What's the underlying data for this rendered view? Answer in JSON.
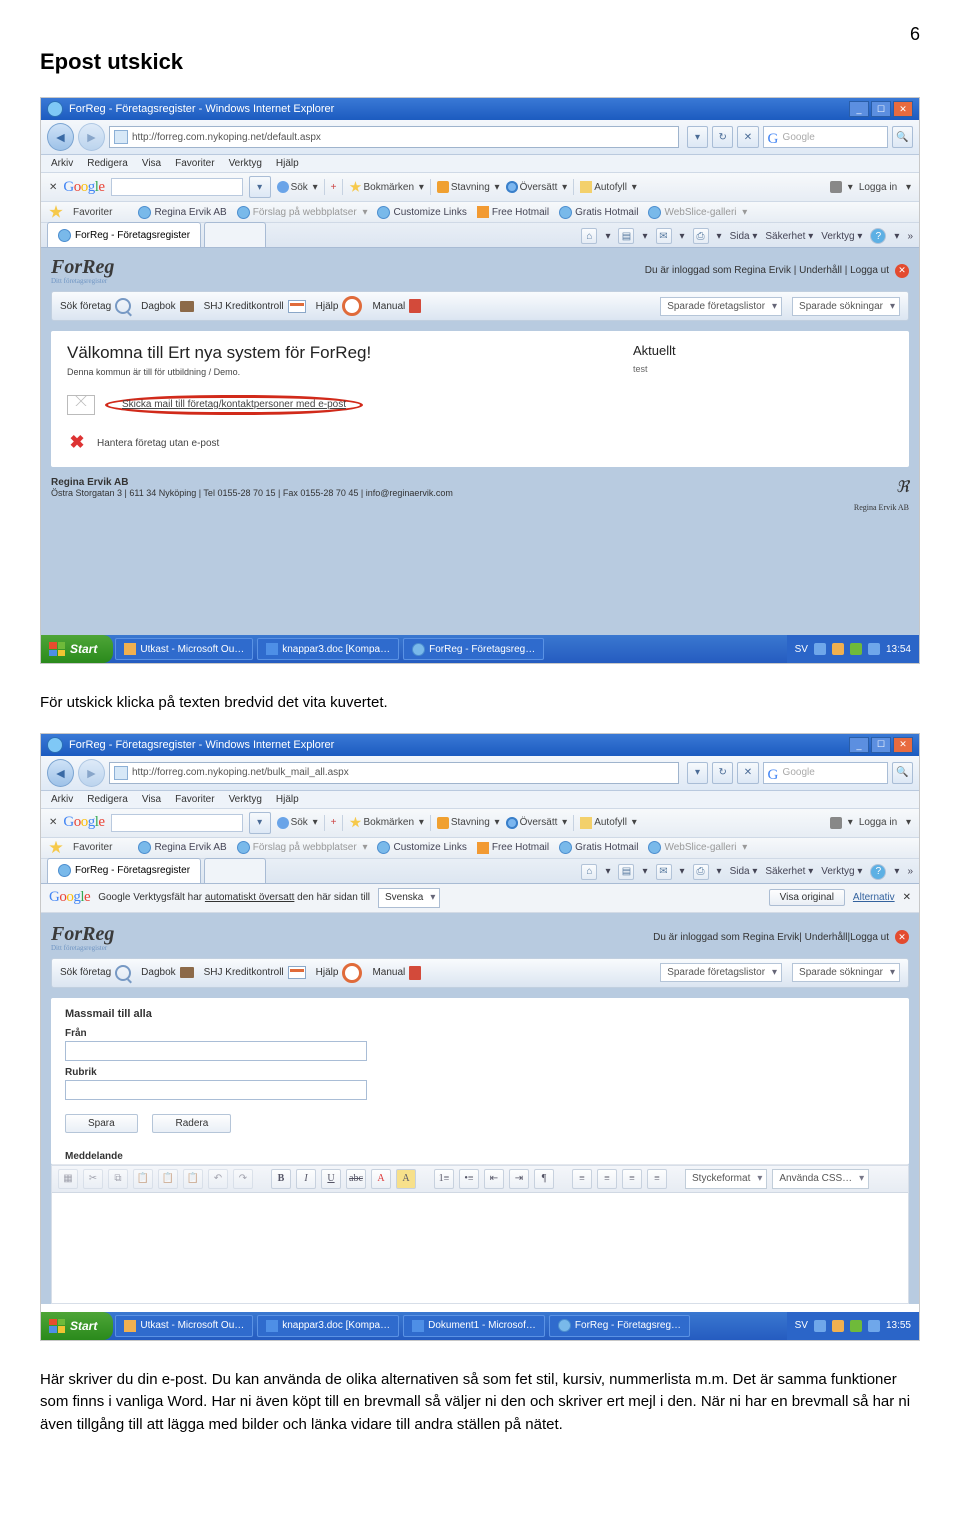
{
  "page": {
    "number": "6",
    "heading": "Epost utskick"
  },
  "para1": "För utskick klicka på texten bredvid det vita kuvertet.",
  "para2": "Här skriver du din e-post. Du kan använda de olika alternativen så som fet stil, kursiv, nummerlista m.m. Det är samma funktioner som finns i vanliga Word.  Har ni även köpt till en brevmall så väljer ni den och skriver ert mejl i den. När ni har en brevmall så har ni även tillgång till att lägga med bilder och länka vidare till andra ställen på nätet.",
  "s1": {
    "window_title": "ForReg - Företagsregister - Windows Internet Explorer",
    "url": "http://forreg.com.nykoping.net/default.aspx",
    "search_placeholder": "Google",
    "menus": [
      "Arkiv",
      "Redigera",
      "Visa",
      "Favoriter",
      "Verktyg",
      "Hjälp"
    ],
    "google_tb": {
      "brand": "Google",
      "search": "Sök",
      "bookmarks": "Bokmärken",
      "spell": "Stavning",
      "translate": "Översätt",
      "autofill": "Autofyll",
      "login": "Logga in"
    },
    "fav": {
      "label": "Favoriter",
      "sites": [
        "Regina Ervik AB",
        "Förslag på webbplatser",
        "Customize Links",
        "Free Hotmail",
        "Gratis Hotmail",
        "WebSlice-galleri"
      ]
    },
    "tab": "ForReg - Företagsregister",
    "cmd": {
      "page": "Sida",
      "safety": "Säkerhet",
      "tools": "Verktyg"
    },
    "app": {
      "logged_in": "Du är inloggad som Regina Ervik | Underhåll | Logga ut",
      "nav": {
        "search": "Sök företag",
        "diary": "Dagbok",
        "credit": "SHJ Kreditkontroll",
        "help": "Hjälp",
        "manual": "Manual",
        "saved_lists": "Sparade företagslistor",
        "saved_search": "Sparade sökningar"
      },
      "welcome_title": "Välkomna till Ert nya system för ForReg!",
      "welcome_sub": "Denna kommun är till för utbildning / Demo.",
      "action_mail": "Skicka mail till företag/kontaktpersoner med e-post",
      "action_nomail": "Hantera företag utan e-post",
      "news_title": "Aktuellt",
      "news_body": "test",
      "footer_name": "Regina Ervik AB",
      "footer_addr": "Östra Storgatan 3 | 611 34 Nyköping | Tel 0155-28 70 15 | Fax 0155-28 70 45 | info@reginaervik.com",
      "footer_brand": "Regina Ervik AB"
    },
    "taskbar": {
      "start": "Start",
      "items": [
        "Utkast - Microsoft Ou…",
        "knappar3.doc [Kompa…",
        "ForReg - Företagsreg…"
      ],
      "lang": "SV",
      "time": "13:54"
    }
  },
  "s2": {
    "window_title": "ForReg - Företagsregister - Windows Internet Explorer",
    "url": "http://forreg.com.nykoping.net/bulk_mail_all.aspx",
    "search_placeholder": "Google",
    "menus": [
      "Arkiv",
      "Redigera",
      "Visa",
      "Favoriter",
      "Verktyg",
      "Hjälp"
    ],
    "google_tb": {
      "brand": "Google",
      "search": "Sök",
      "bookmarks": "Bokmärken",
      "spell": "Stavning",
      "translate": "Översätt",
      "autofill": "Autofyll",
      "login": "Logga in"
    },
    "fav": {
      "label": "Favoriter",
      "sites": [
        "Regina Ervik AB",
        "Förslag på webbplatser",
        "Customize Links",
        "Free Hotmail",
        "Gratis Hotmail",
        "WebSlice-galleri"
      ]
    },
    "tab": "ForReg - Företagsregister",
    "cmd": {
      "page": "Sida",
      "safety": "Säkerhet",
      "tools": "Verktyg"
    },
    "gtrans": {
      "text": "Google Verktygsfält har ",
      "link": "automatiskt översatt",
      "rest": " den här sidan till",
      "lang": "Svenska",
      "orig": "Visa original",
      "alt": "Alternativ"
    },
    "app": {
      "logged_in": "Du är inloggad som Regina Ervik| Underhåll|Logga ut",
      "nav": {
        "search": "Sök företag",
        "diary": "Dagbok",
        "credit": "SHJ Kreditkontroll",
        "help": "Hjälp",
        "manual": "Manual",
        "saved_lists": "Sparade företagslistor",
        "saved_search": "Sparade sökningar"
      },
      "form_title": "Massmail till alla",
      "from_lbl": "Från",
      "subject_lbl": "Rubrik",
      "save": "Spara",
      "delete": "Radera",
      "message_lbl": "Meddelande",
      "ed_dd1": "Styckeformat",
      "ed_dd2": "Använda CSS…"
    },
    "taskbar": {
      "start": "Start",
      "items": [
        "Utkast - Microsoft Ou…",
        "knappar3.doc [Kompa…",
        "Dokument1 - Microsof…",
        "ForReg - Företagsreg…"
      ],
      "lang": "SV",
      "time": "13:55"
    }
  }
}
